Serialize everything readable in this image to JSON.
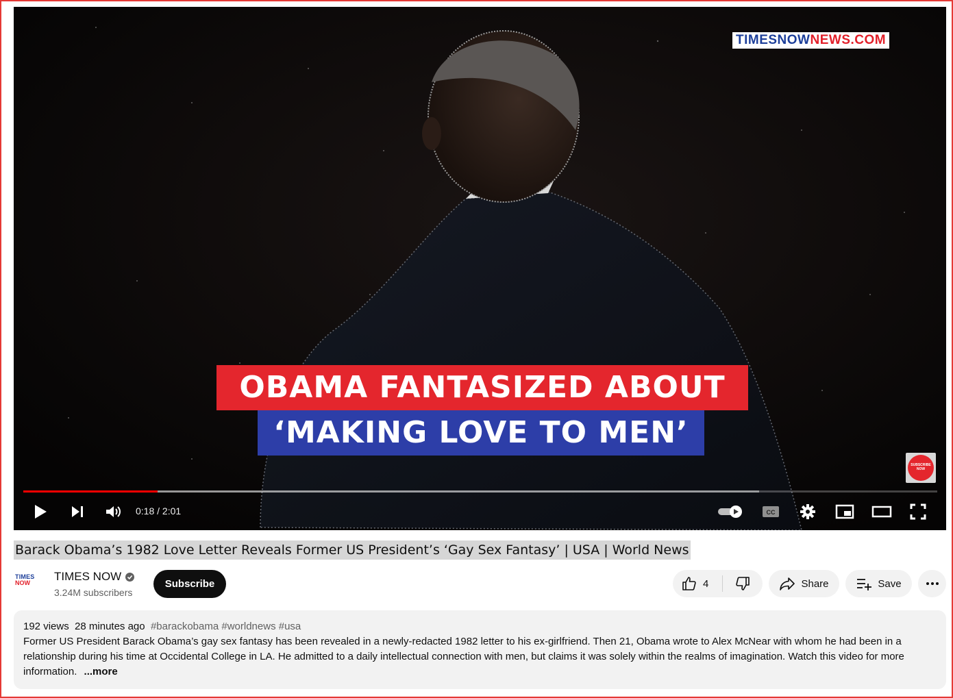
{
  "video": {
    "watermark_a": "TIMESNOW",
    "watermark_b": "NEWS.COM",
    "overlay_line1": "OBAMA FANTASIZED ABOUT",
    "overlay_line2": "‘MAKING LOVE TO MEN’",
    "subscribe_badge_line1": "SUBSCRIBE",
    "subscribe_badge_line2": "NOW",
    "time_display": "0:18 / 2:01",
    "progress_played_fraction": 0.147,
    "progress_loaded_fraction": 0.805,
    "controls": {
      "play": "play-icon",
      "next": "next-icon",
      "volume": "volume-icon",
      "autoplay": "autoplay-toggle-icon",
      "captions": "captions-icon",
      "settings": "gear-icon",
      "miniplayer": "miniplayer-icon",
      "theater": "theater-mode-icon",
      "fullscreen": "fullscreen-icon"
    }
  },
  "title": "Barack Obama’s 1982 Love Letter Reveals Former US President’s ‘Gay Sex Fantasy’ | USA | World News",
  "channel": {
    "logo_top": "TIMES",
    "logo_bottom": "NOW",
    "name": "TIMES NOW",
    "subscribers": "3.24M subscribers",
    "subscribe_label": "Subscribe"
  },
  "actions": {
    "like_count": "4",
    "share_label": "Share",
    "save_label": "Save"
  },
  "description": {
    "views": "192 views",
    "age": "28 minutes ago",
    "hashtags": "#barackobama #worldnews #usa",
    "text": "Former US President Barack Obama’s gay sex fantasy has been revealed in a newly-redacted 1982 letter to his ex-girlfriend. Then 21, Obama wrote to Alex McNear with whom he had been in a relationship during his time at Occidental College in LA. He admitted to a daily intellectual connection with men, but claims it was solely within the realms of imagination. Watch this video for more information.",
    "more_label": "...more"
  },
  "colors": {
    "overlay_red": "#e4262d",
    "overlay_blue": "#2d3ea8",
    "progress_red": "#ff0000",
    "subscribe_bg": "#0f0f0f"
  }
}
